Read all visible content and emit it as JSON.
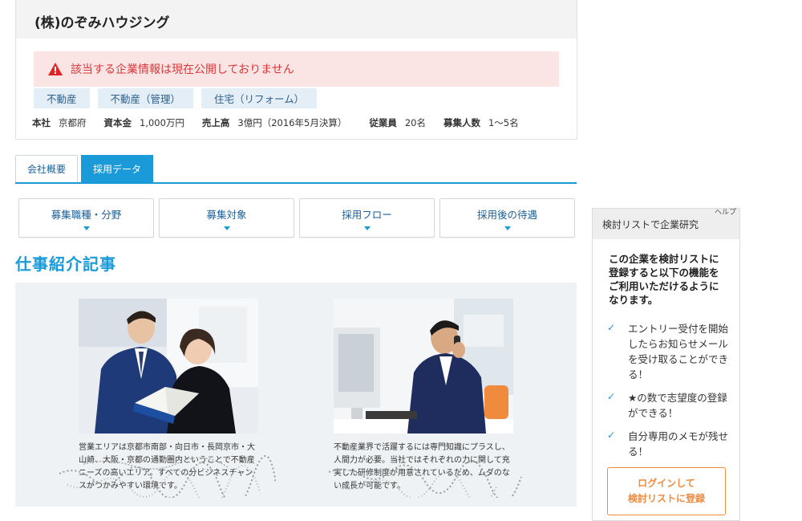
{
  "company": {
    "name": "(株)のぞみハウジング",
    "alert": "該当する企業情報は現在公開しておりません",
    "tags": [
      "不動産",
      "不動産（管理）",
      "住宅（リフォーム）"
    ],
    "stats": [
      {
        "label": "本社",
        "value": "京都府"
      },
      {
        "label": "資本金",
        "value": "1,000万円"
      },
      {
        "label": "売上高",
        "value": "3億円（2016年5月決算）"
      },
      {
        "label": "従業員",
        "value": "20名"
      },
      {
        "label": "募集人数",
        "value": "1〜5名"
      }
    ]
  },
  "tabs": [
    "会社概要",
    "採用データ"
  ],
  "subnav": [
    "募集職種・分野",
    "募集対象",
    "採用フロー",
    "採用後の待遇"
  ],
  "section_title": "仕事紹介記事",
  "articles": [
    {
      "text": "営業エリアは京都市南部・向日市・長岡京市・大山崎、大阪・京都の通勤圏内ということで不動産ニーズの高いエリア。すべての分ビジネスチャンスがつかみやすい環境です。"
    },
    {
      "text": "不動産業界で活躍するには専門知識にプラスし、人間力が必要。当社ではそれぞれの力に関して充実した研修制度が用意されているため、ムダのない成長が可能です。"
    }
  ],
  "sidebar": {
    "header": "検討リストで企業研究",
    "help": "ヘルプ",
    "lead": "この企業を検討リストに登録すると以下の機能をご利用いただけるようになります。",
    "features": [
      "エントリー受付を開始したらお知らせメールを受け取ることができる！",
      "★の数で志望度の登録ができる！",
      "自分専用のメモが残せる！"
    ],
    "login_line1": "ログインして",
    "login_line2": "検討リストに登録"
  },
  "colors": {
    "accent": "#1a9ad8",
    "alert": "#d9383a",
    "login": "#f08a3c"
  }
}
